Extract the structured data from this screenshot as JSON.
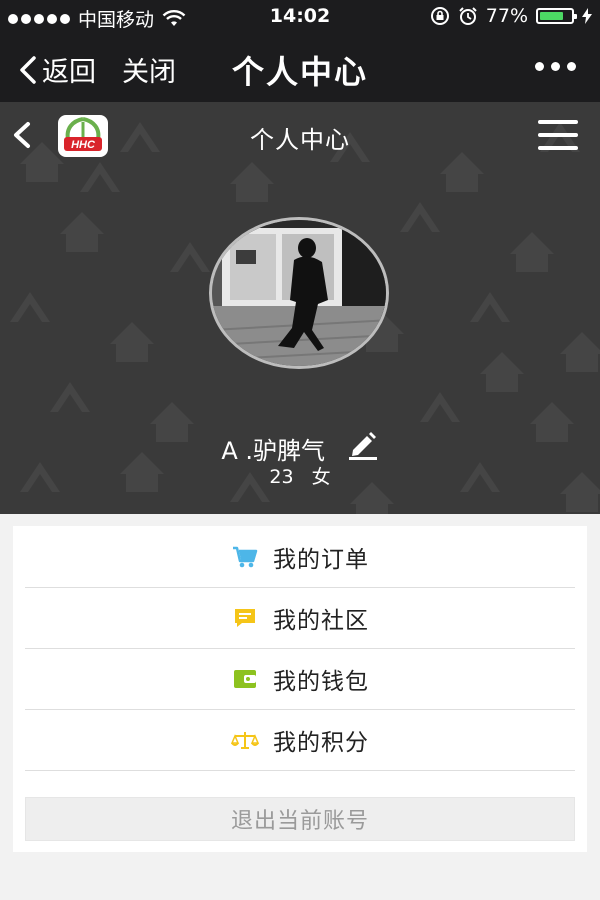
{
  "status_bar": {
    "carrier": "中国移动",
    "time": "14:02",
    "battery_percent": "77%",
    "battery_level": 0.77,
    "icons": [
      "signal-dots-icon",
      "wifi-icon",
      "orientation-lock-icon",
      "alarm-icon",
      "battery-icon",
      "charging-icon"
    ]
  },
  "wechat_nav": {
    "back_label": "返回",
    "close_label": "关闭",
    "title": "个人中心",
    "more_icon": "more-dots-icon"
  },
  "page_header": {
    "title": "个人中心",
    "logo_text": "HHC",
    "back_icon": "chevron-left-icon",
    "menu_icon": "hamburger-menu-icon"
  },
  "profile": {
    "name": "A .驴脾气",
    "age": "23",
    "gender": "女",
    "edit_icon": "pencil-edit-icon"
  },
  "menu": [
    {
      "label": "我的订单",
      "icon": "cart-icon",
      "color": "#4db6e8"
    },
    {
      "label": "我的社区",
      "icon": "chat-bubble-icon",
      "color": "#f5c518"
    },
    {
      "label": "我的钱包",
      "icon": "wallet-icon",
      "color": "#8dc21f"
    },
    {
      "label": "我的积分",
      "icon": "scale-icon",
      "color": "#f5c518"
    }
  ],
  "logout_label": "退出当前账号",
  "colors": {
    "bar_bg": "#1c1c1e",
    "hero_bg": "#3a3a3a",
    "battery": "#4cd964",
    "page_bg": "#f2f2f2"
  }
}
